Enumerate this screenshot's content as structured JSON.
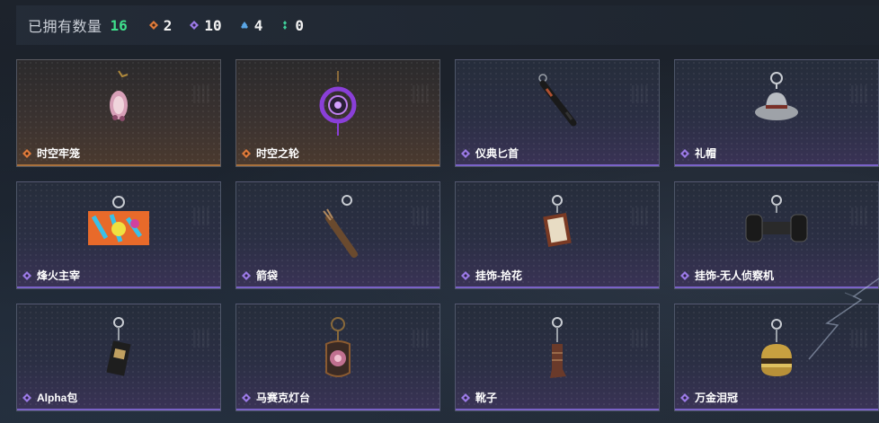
{
  "header": {
    "owned_label": "已拥有数量",
    "owned_total": "16",
    "rarities": [
      {
        "icon": "orange-diamond-icon",
        "color": "#e07b3a",
        "count": "2"
      },
      {
        "icon": "purple-diamond-icon",
        "color": "#9b7ae6",
        "count": "10"
      },
      {
        "icon": "blue-diamond-icon",
        "color": "#5aa6e6",
        "count": "4"
      },
      {
        "icon": "green-diamond-icon",
        "color": "#3fcf9a",
        "count": "0"
      }
    ]
  },
  "items": [
    {
      "name": "时空牢笼",
      "rarity": "orange",
      "icon": "cage-pendant-icon"
    },
    {
      "name": "时空之轮",
      "rarity": "orange",
      "icon": "wheel-pendant-icon"
    },
    {
      "name": "仪典匕首",
      "rarity": "purple",
      "icon": "dagger-pendant-icon"
    },
    {
      "name": "礼帽",
      "rarity": "purple",
      "icon": "hat-pendant-icon"
    },
    {
      "name": "烽火主宰",
      "rarity": "purple",
      "icon": "graffiti-box-icon"
    },
    {
      "name": "箭袋",
      "rarity": "purple",
      "icon": "quiver-pendant-icon"
    },
    {
      "name": "挂饰-拾花",
      "rarity": "purple",
      "icon": "frame-pendant-icon"
    },
    {
      "name": "挂饰-无人侦察机",
      "rarity": "purple",
      "icon": "drone-pendant-icon"
    },
    {
      "name": "Alpha包",
      "rarity": "purple",
      "icon": "bag-pendant-icon"
    },
    {
      "name": "马赛克灯台",
      "rarity": "purple",
      "icon": "lamp-pendant-icon"
    },
    {
      "name": "靴子",
      "rarity": "purple",
      "icon": "boot-pendant-icon"
    },
    {
      "name": "万金泪冠",
      "rarity": "purple",
      "icon": "burger-pendant-icon"
    }
  ],
  "colors": {
    "orange": "#e07b3a",
    "purple": "#9b7ae6",
    "owned_total": "#3fe08c"
  }
}
